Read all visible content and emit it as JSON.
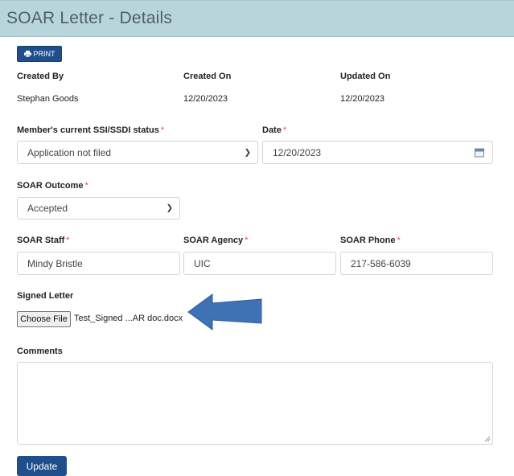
{
  "header": {
    "title": "SOAR Letter - Details"
  },
  "toolbar": {
    "print_label": "PRINT",
    "print_icon": "printer-icon"
  },
  "meta": {
    "created_by_label": "Created By",
    "created_on_label": "Created On",
    "updated_on_label": "Updated On",
    "created_by": "Stephan Goods",
    "created_on": "12/20/2023",
    "updated_on": "12/20/2023"
  },
  "form": {
    "ssi_status": {
      "label": "Member's current SSI/SSDI status",
      "value": "Application not filed"
    },
    "date": {
      "label": "Date",
      "value": "12/20/2023"
    },
    "outcome": {
      "label": "SOAR Outcome",
      "value": "Accepted"
    },
    "staff": {
      "label": "SOAR Staff",
      "value": "Mindy Bristle"
    },
    "agency": {
      "label": "SOAR Agency",
      "value": "UIC"
    },
    "phone": {
      "label": "SOAR Phone",
      "value": "217-586-6039"
    },
    "signed_letter": {
      "label": "Signed Letter",
      "button": "Choose File",
      "file_name": "Test_Signed ...AR doc.docx"
    },
    "comments": {
      "label": "Comments",
      "value": ""
    },
    "required_marker": "*",
    "update_label": "Update"
  },
  "colors": {
    "header_bg": "#b9d5dc",
    "primary": "#1f4e8c",
    "required": "#d9534f",
    "arrow": "#3d72b5"
  }
}
